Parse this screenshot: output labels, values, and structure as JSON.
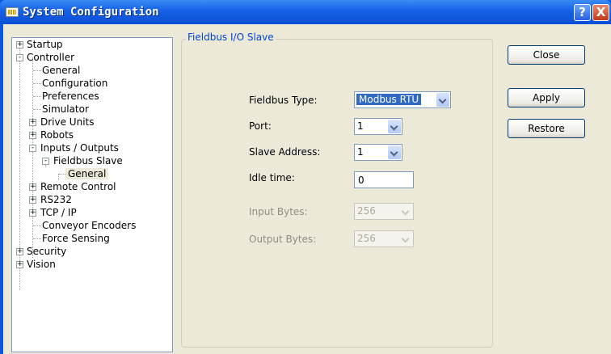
{
  "window": {
    "title": "System Configuration",
    "help_label": "?",
    "close_label": "X"
  },
  "tree": {
    "expand_plus": "+",
    "collapse_minus": "-",
    "items": [
      {
        "label": "Startup",
        "expander": "+"
      },
      {
        "label": "Controller",
        "expander": "-"
      },
      {
        "label": "General"
      },
      {
        "label": "Configuration"
      },
      {
        "label": "Preferences"
      },
      {
        "label": "Simulator"
      },
      {
        "label": "Drive Units",
        "expander": "+"
      },
      {
        "label": "Robots",
        "expander": "+"
      },
      {
        "label": "Inputs / Outputs",
        "expander": "-"
      },
      {
        "label": "Fieldbus Slave",
        "expander": "-"
      },
      {
        "label": "General",
        "selected": true
      },
      {
        "label": "Remote Control",
        "expander": "+"
      },
      {
        "label": "RS232",
        "expander": "+"
      },
      {
        "label": "TCP / IP",
        "expander": "+"
      },
      {
        "label": "Conveyor Encoders"
      },
      {
        "label": "Force Sensing"
      },
      {
        "label": "Security",
        "expander": "+"
      },
      {
        "label": "Vision",
        "expander": "+"
      }
    ]
  },
  "panel": {
    "group_title": "Fieldbus I/O Slave",
    "fieldbus_type": {
      "label": "Fieldbus Type:",
      "value": "Modbus RTU"
    },
    "port": {
      "label": "Port:",
      "value": "1"
    },
    "slave_address": {
      "label": "Slave Address:",
      "value": "1"
    },
    "idle_time": {
      "label": "Idle time:",
      "value": "0"
    },
    "input_bytes": {
      "label": "Input Bytes:",
      "value": "256"
    },
    "output_bytes": {
      "label": "Output Bytes:",
      "value": "256"
    }
  },
  "buttons": {
    "close": "Close",
    "apply": "Apply",
    "restore": "Restore"
  }
}
